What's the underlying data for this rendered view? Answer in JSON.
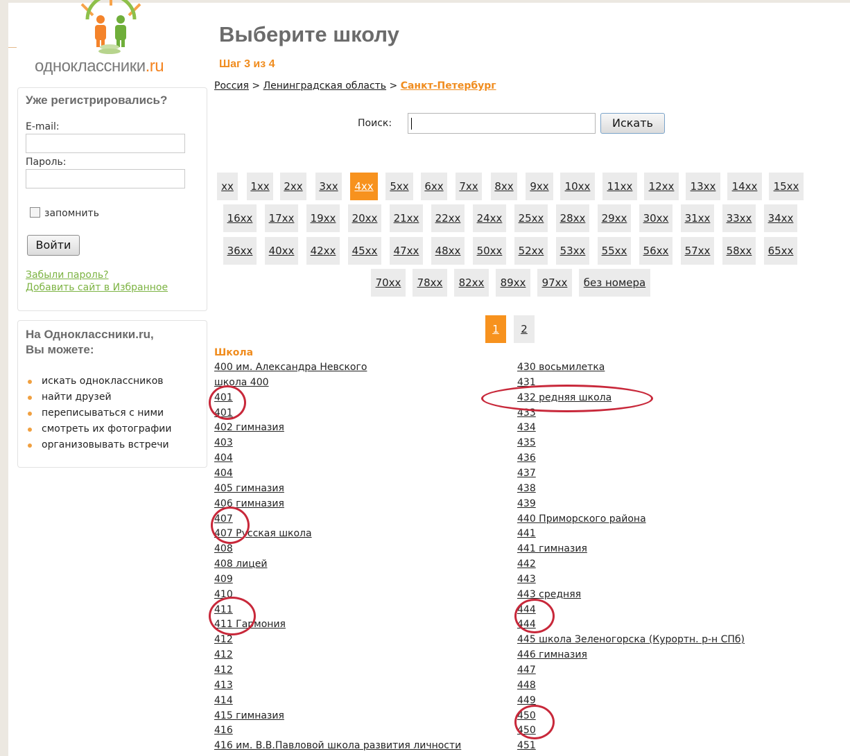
{
  "logo": {
    "text_main": "одноклассники",
    "text_suffix": ".ru"
  },
  "login_panel": {
    "title": "Уже регистрировались?",
    "email_label": "E-mail:",
    "password_label": "Пароль:",
    "remember_label": "запомнить",
    "login_button": "Войти",
    "forgot_link": "Забыли пароль?",
    "favorite_link": "Добавить сайт в Избранное"
  },
  "info_panel": {
    "title_line1": "На Одноклассники.ru,",
    "title_line2": "Вы можете:",
    "items": [
      "искать одноклассников",
      "найти друзей",
      "переписываться с ними",
      "смотреть их фотографии",
      "организовывать встречи"
    ]
  },
  "header": {
    "title": "Выберите школу",
    "step": "Шаг 3 из 4"
  },
  "breadcrumb": {
    "country": "Россия",
    "sep": ">",
    "region": "Ленинградская область",
    "city": "Санкт-Петербург"
  },
  "search": {
    "label": "Поиск:",
    "button": "Искать",
    "value": ""
  },
  "number_filter": {
    "active": "4xx",
    "rows": [
      [
        "xx",
        "1xx",
        "2xx",
        "3xx",
        "4xx",
        "5xx",
        "6xx",
        "7xx",
        "8xx",
        "9xx",
        "10xx",
        "11xx",
        "12xx",
        "13xx",
        "14xx",
        "15xx"
      ],
      [
        "16xx",
        "17xx",
        "19xx",
        "20xx",
        "21xx",
        "22xx",
        "24xx",
        "25xx",
        "28xx",
        "29xx",
        "30xx",
        "31xx",
        "33xx",
        "34xx"
      ],
      [
        "36xx",
        "40xx",
        "42xx",
        "45xx",
        "47xx",
        "48xx",
        "50xx",
        "52xx",
        "53xx",
        "55xx",
        "56xx",
        "57xx",
        "58xx",
        "65xx"
      ],
      [
        "70xx",
        "78xx",
        "82xx",
        "89xx",
        "97xx",
        "без номера"
      ]
    ]
  },
  "pagination": {
    "pages": [
      "1",
      "2"
    ],
    "active": "1"
  },
  "list": {
    "heading": "Школа",
    "left": [
      "400 им. Александра Невского",
      "школа 400",
      "401",
      "401",
      "402 гимназия",
      "403",
      "404",
      "404",
      "405 гимназия",
      "406 гимназия",
      "407",
      "407 Русская школа",
      "408",
      "408 лицей",
      "409",
      "410",
      "411",
      "411 Гармония",
      "412",
      "412",
      "412",
      "413",
      "414",
      "415 гимназия",
      "416",
      "416 им. В.В.Павловой школа развития личности"
    ],
    "right": [
      "430 восьмилетка",
      "431",
      "432 редняя школа",
      "433",
      "434",
      "435",
      "436",
      "437",
      "438",
      "439",
      "440 Приморского района",
      "441",
      "441 гимназия",
      "442",
      "443",
      "443 средняя",
      "444",
      "444",
      "445 школа Зеленогорска (Курортн. р-н СПб)",
      "446 гимназия",
      "447",
      "448",
      "449",
      "450",
      "450",
      "451"
    ]
  },
  "colors": {
    "accent": "#f7921e",
    "annotation": "#c8283a",
    "link_green": "#7cb342"
  }
}
